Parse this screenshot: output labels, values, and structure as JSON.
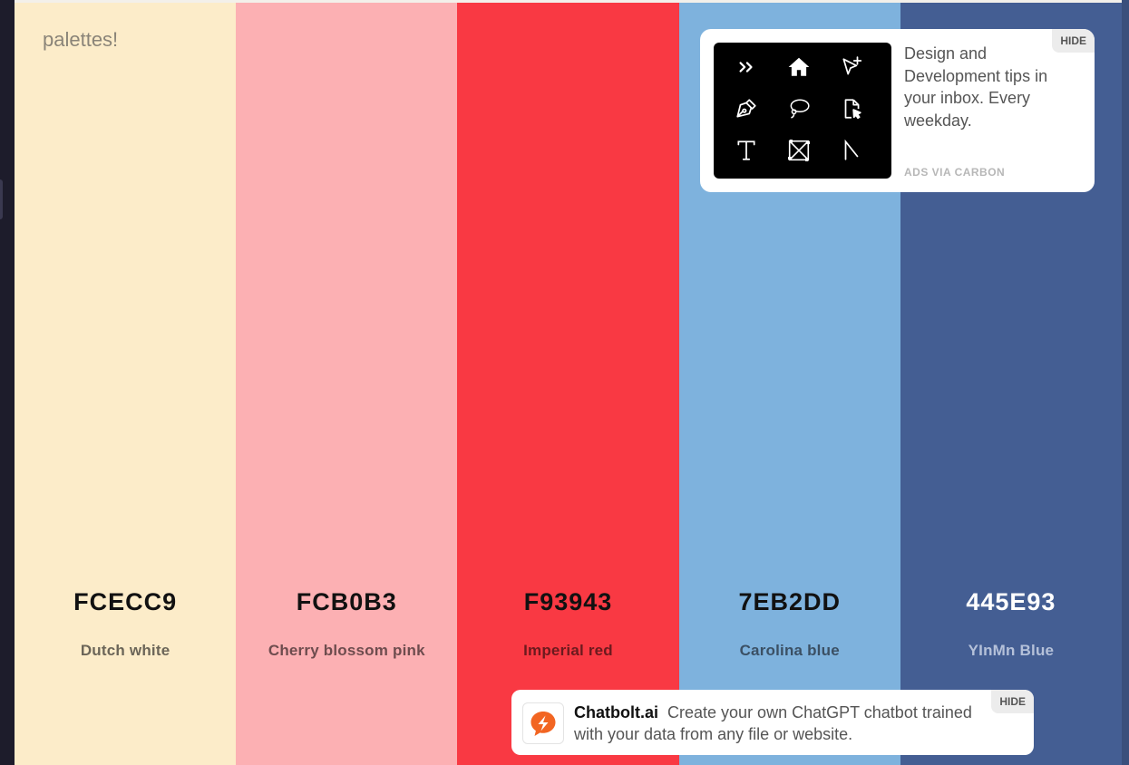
{
  "brand_text": "palettes!",
  "swatches": [
    {
      "hex": "FCECC9",
      "name": "Dutch white",
      "bg": "#FCECC9",
      "hex_color": "#111111",
      "name_color": "#6b6558"
    },
    {
      "hex": "FCB0B3",
      "name": "Cherry blossom pink",
      "bg": "#FCB0B3",
      "hex_color": "#111111",
      "name_color": "#6e4c4e"
    },
    {
      "hex": "F93943",
      "name": "Imperial red",
      "bg": "#F93943",
      "hex_color": "#111111",
      "name_color": "#6b1a1e"
    },
    {
      "hex": "7EB2DD",
      "name": "Carolina blue",
      "bg": "#7EB2DD",
      "hex_color": "#111111",
      "name_color": "#3b5064"
    },
    {
      "hex": "445E93",
      "name": "YInMn Blue",
      "bg": "#445E93",
      "hex_color": "#ffffff",
      "name_color": "#b5c1d9"
    }
  ],
  "carbon_ad": {
    "description": "Design and Development tips in your inbox. Every weekday.",
    "via": "ADS VIA CARBON",
    "hide": "HIDE",
    "icons": [
      "chevrons-right-icon",
      "home-icon",
      "cursor-plus-icon",
      "pen-nib-icon",
      "lasso-icon",
      "file-cursor-icon",
      "text-tool-icon",
      "frame-icon",
      "line-tool-icon"
    ]
  },
  "chatbolt_ad": {
    "brand": "Chatbolt.ai",
    "message": "Create your own ChatGPT chatbot trained with your data from any file or website.",
    "hide": "HIDE",
    "accent": "#f26522"
  }
}
